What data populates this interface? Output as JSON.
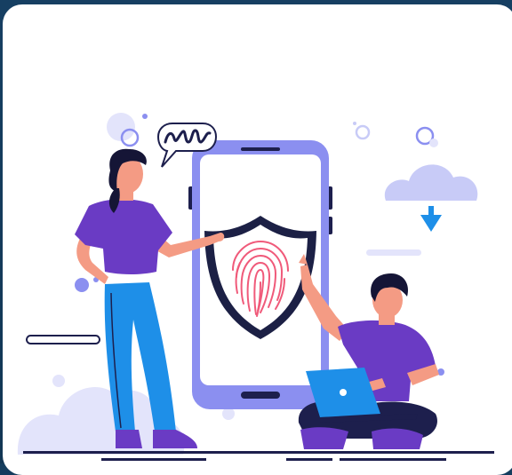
{
  "illustration": {
    "subject": "fingerprint-security",
    "icons": [
      "shield-icon",
      "fingerprint-icon",
      "cloud-download-icon",
      "speech-bubble-icon",
      "laptop-icon",
      "smartphone-icon"
    ],
    "colors": {
      "background": "#153d5e",
      "card": "#ffffff",
      "phone_frame": "#8b8ff0",
      "phone_screen": "#ffffff",
      "shield_dark": "#1c2045",
      "fingerprint": "#f05a7a",
      "purple_shirt": "#6a3bc4",
      "blue_jeans": "#1e8fe8",
      "navy": "#1d1f4d",
      "skin": "#f49b84",
      "hair": "#151536",
      "cloud": "#c8cbf7",
      "cloud_light": "#e3e4fb",
      "arrow": "#1e8fe8"
    }
  }
}
